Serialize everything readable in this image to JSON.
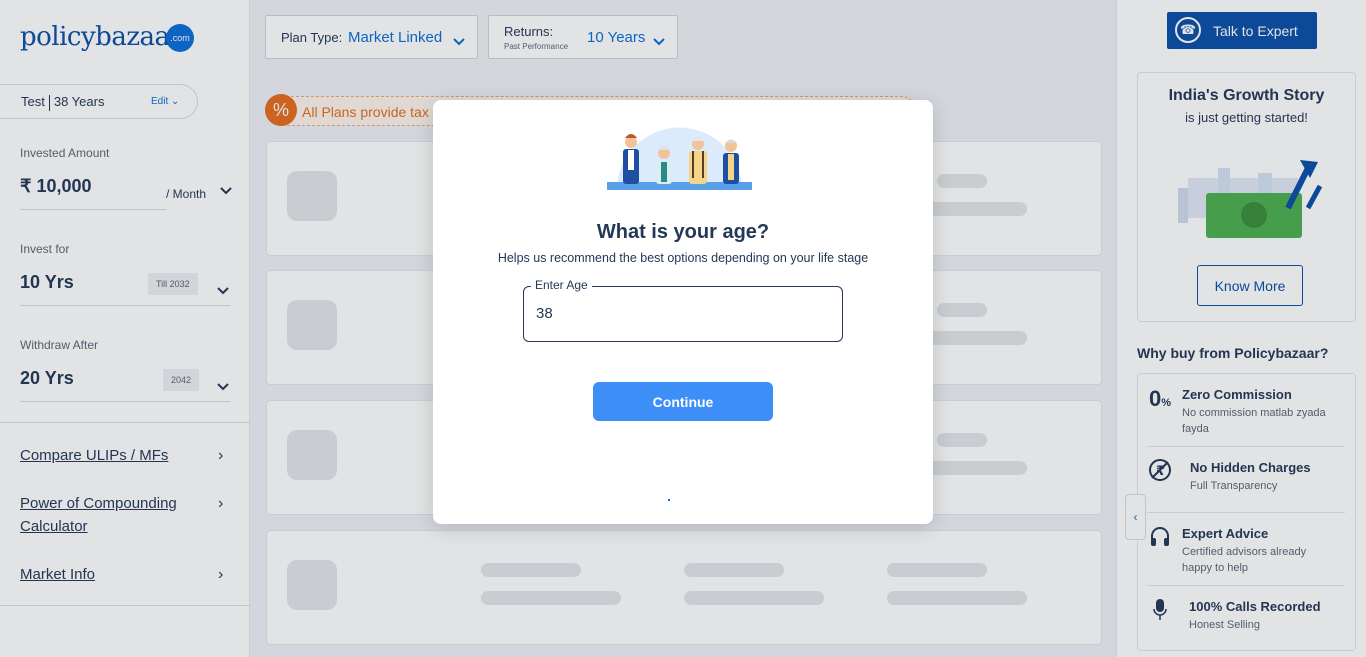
{
  "sidebar": {
    "logo_text": "policybazaar",
    "logo_badge": ".com",
    "profile": {
      "name": "Test",
      "age": "38 Years",
      "edit_label": "Edit"
    },
    "invested_amount": {
      "label": "Invested Amount",
      "value": "₹ 10,000",
      "unit": "/ Month"
    },
    "invest_for": {
      "label": "Invest for",
      "value": "10 Yrs",
      "tag": "Till 2032"
    },
    "withdraw_after": {
      "label": "Withdraw After",
      "value": "20 Yrs",
      "tag": "2042"
    },
    "links": [
      {
        "label": "Compare ULIPs / MFs"
      },
      {
        "label": "Power of Compounding Calculator"
      },
      {
        "label": "Market Info"
      }
    ]
  },
  "filters": {
    "plan_type": {
      "label": "Plan Type:",
      "value": "Market Linked"
    },
    "returns": {
      "label": "Returns:",
      "sublabel": "Past Performance",
      "value": "10 Years"
    }
  },
  "main": {
    "tax_banner": "All Plans provide tax"
  },
  "right_panel": {
    "talk_button": "Talk to Expert",
    "growth_title": "India's Growth Story",
    "growth_sub": "is just getting started!",
    "know_more": "Know More",
    "why_title": "Why buy from Policybazaar?",
    "why_items": [
      {
        "icon": "zero-percent-icon",
        "title": "Zero Commission",
        "desc": "No commission matlab zyada fayda"
      },
      {
        "icon": "no-rupee-icon",
        "title": "No Hidden Charges",
        "desc": "Full Transparency"
      },
      {
        "icon": "headset-icon",
        "title": "Expert Advice",
        "desc": "Certified advisors already happy to help"
      },
      {
        "icon": "microphone-icon",
        "title": "100% Calls Recorded",
        "desc": "Honest Selling"
      }
    ]
  },
  "modal": {
    "title": "What is your age?",
    "subtitle": "Helps us recommend the best options depending on your life stage",
    "field_label": "Enter Age",
    "field_value": "38",
    "continue_label": "Continue"
  },
  "colors": {
    "brand_blue": "#0a4fa8",
    "accent_blue": "#3e8ef7",
    "tax_orange": "#e56d1f",
    "text_dark": "#253858"
  }
}
